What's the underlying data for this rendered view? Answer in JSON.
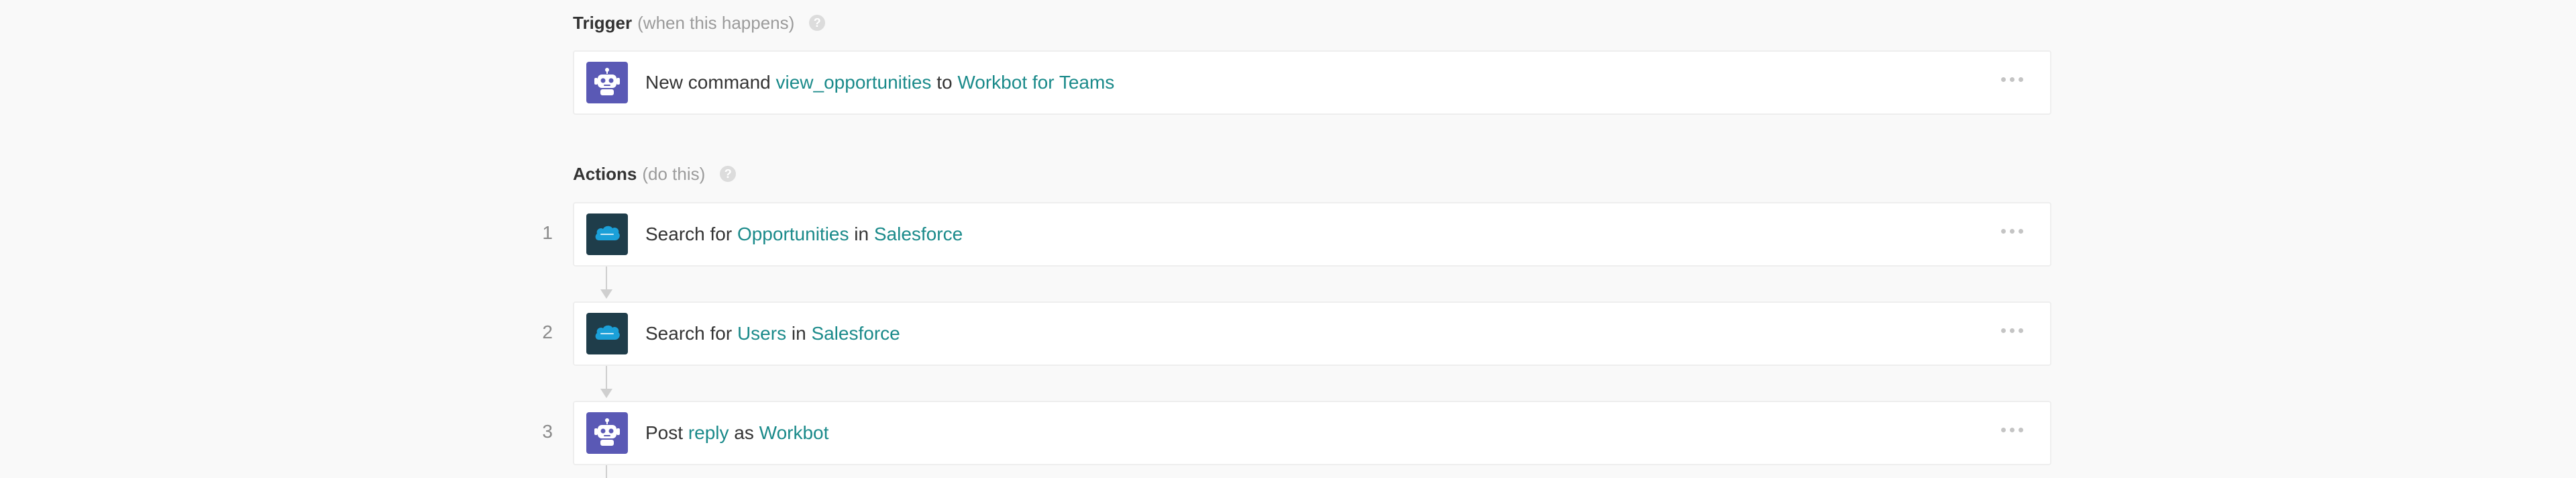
{
  "trigger": {
    "heading": "Trigger",
    "subheading": "(when this happens)",
    "help_icon": "?",
    "card": {
      "icon": "workbot-icon",
      "prefix": "New command ",
      "command": "view_opportunities",
      "middle": " to ",
      "app": "Workbot for Teams"
    }
  },
  "actions": {
    "heading": "Actions",
    "subheading": "(do this)",
    "help_icon": "?",
    "steps": [
      {
        "number": "1",
        "icon": "salesforce-icon",
        "prefix": "Search for ",
        "object": "Opportunities",
        "middle": " in ",
        "app": "Salesforce"
      },
      {
        "number": "2",
        "icon": "salesforce-icon",
        "prefix": "Search for ",
        "object": "Users",
        "middle": " in ",
        "app": "Salesforce"
      },
      {
        "number": "3",
        "icon": "workbot-icon",
        "prefix": "Post ",
        "object": "reply",
        "middle": " as ",
        "app": "Workbot"
      }
    ]
  },
  "colors": {
    "accent_link": "#1a8a8a",
    "workbot_bg": "#5a59b5",
    "salesforce_bg": "#1f3d4a"
  }
}
